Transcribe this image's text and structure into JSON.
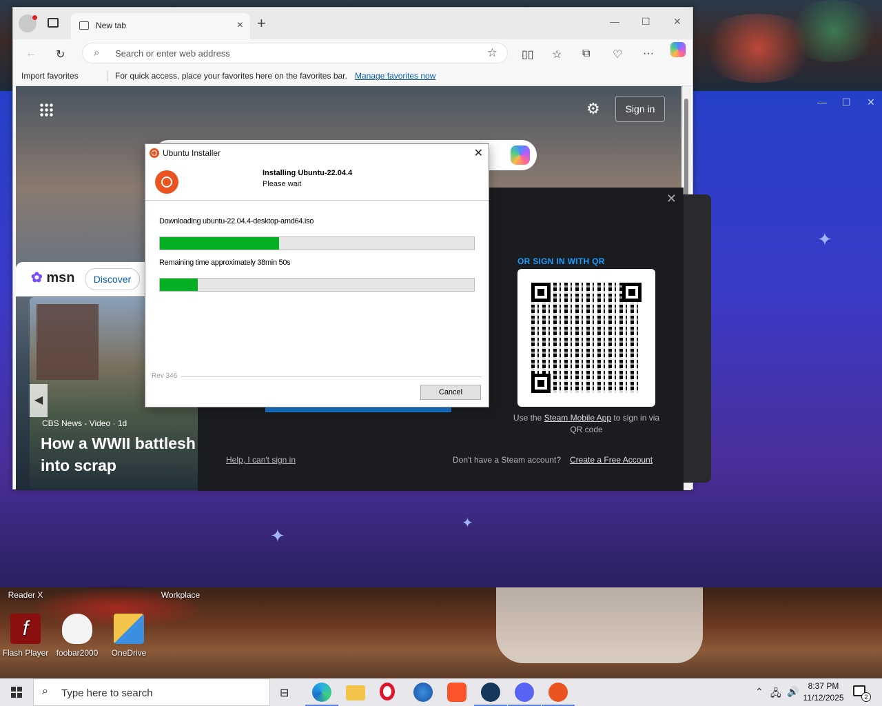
{
  "browser": {
    "tab_title": "New tab",
    "address_placeholder": "Search or enter web address",
    "favorites": {
      "import_label": "Import favorites",
      "message": "For quick access, place your favorites here on the favorites bar.",
      "manage_link": "Manage favorites now"
    },
    "page": {
      "sign_in": "Sign in",
      "msn_logo": "msn",
      "discover": "Discover",
      "news_source": "CBS News - Video · 1d",
      "headline": "How a WWII battlesh into scrap"
    }
  },
  "steam": {
    "qr_label": "OR SIGN IN WITH QR",
    "qr_text_prefix": "Use the",
    "qr_link": "Steam Mobile App",
    "qr_text_suffix": "to sign in via QR code",
    "help_link": "Help, I can't sign in",
    "no_account": "Don't have a Steam account?",
    "create_link": "Create a Free Account"
  },
  "installer": {
    "window_title": "Ubuntu Installer",
    "heading": "Installing Ubuntu-22.04.4",
    "subheading": "Please wait",
    "download_label": "Downloading ubuntu-22.04.4-desktop-amd64.iso",
    "progress_download": 0.38,
    "remaining_label": "Remaining time approximately 38min 50s",
    "progress_overall": 0.12,
    "revision": "Rev 346",
    "cancel_label": "Cancel"
  },
  "desktop_icons": [
    {
      "label": "Reader X",
      "name": "adobe-reader-x"
    },
    {
      "label": "Workplace",
      "name": "zoom-workplace"
    },
    {
      "label": "Flash Player",
      "name": "flash-player"
    },
    {
      "label": "foobar2000",
      "name": "foobar2000"
    },
    {
      "label": "OneDrive",
      "name": "onedrive"
    }
  ],
  "taskbar": {
    "search_placeholder": "Type here to search",
    "time": "8:37 PM",
    "date": "11/12/2025",
    "notification_count": "2"
  },
  "colors": {
    "ubuntu_orange": "#e95420",
    "progress_green": "#06b025",
    "steam_blue": "#1a9fff",
    "link_blue": "#0a5fb4"
  }
}
